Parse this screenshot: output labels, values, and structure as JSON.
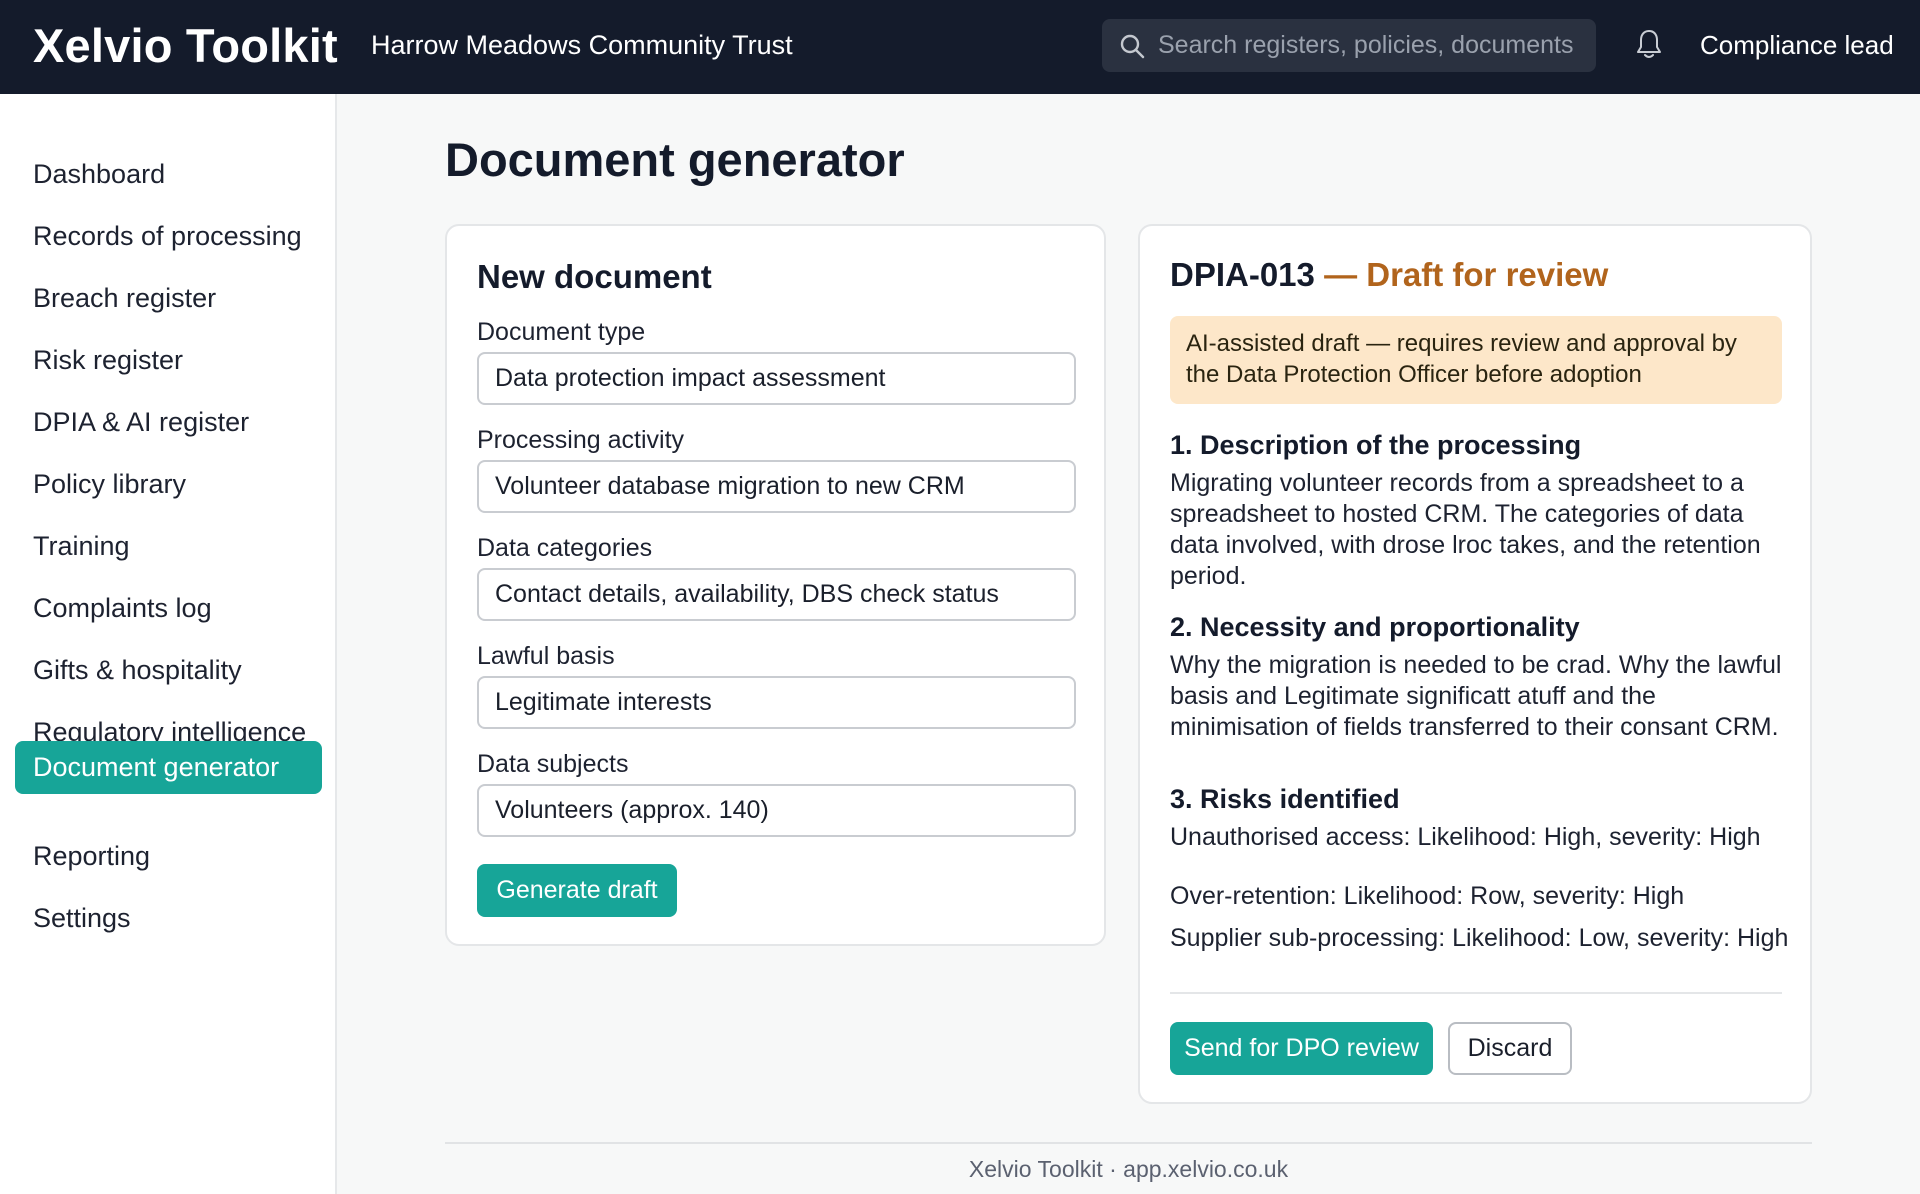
{
  "app": {
    "brand": "Xelvio Toolkit",
    "organisation": "Harrow Meadows Community Trust",
    "user_label": "Compliance lead"
  },
  "search": {
    "placeholder": "Search registers, policies, documents",
    "icon": "search-icon"
  },
  "notifications": {
    "icon": "bell-icon"
  },
  "sidebar": {
    "items": [
      {
        "label": "Dashboard"
      },
      {
        "label": "Records of processing"
      },
      {
        "label": "Breach register"
      },
      {
        "label": "Risk register"
      },
      {
        "label": "DPIA & AI register"
      },
      {
        "label": "Policy library"
      },
      {
        "label": "Training"
      },
      {
        "label": "Complaints log"
      },
      {
        "label": "Gifts & hospitality"
      },
      {
        "label": "Regulatory intelligence"
      },
      {
        "label": "Document generator",
        "active": true
      },
      {
        "label": "Reporting"
      },
      {
        "label": "Settings"
      }
    ]
  },
  "main": {
    "title": "Document generator"
  },
  "form": {
    "title": "New document",
    "fields": [
      {
        "label": "Document type",
        "value": "Data protection impact assessment"
      },
      {
        "label": "Processing activity",
        "value": "Volunteer database migration to new CRM"
      },
      {
        "label": "Data categories",
        "value": "Contact details, availability, DBS check status"
      },
      {
        "label": "Lawful basis",
        "value": "Legitimate interests"
      },
      {
        "label": "Data subjects",
        "value": "Volunteers (approx. 140)"
      }
    ],
    "generate_label": "Generate draft"
  },
  "draft": {
    "id": "DPIA-013",
    "separator": "—",
    "status": "Draft for review",
    "notice": "AI-assisted draft — requires review and approval by the Data Protection Officer before adoption",
    "sections": [
      {
        "title": "1. Description of the processing",
        "lines": [
          "Migrating volunteer records from a spreadsheet to a",
          "spreadsheet to hosted CRM. The categories of data",
          "data involved, with drose lroc takes, and the retention",
          "period."
        ]
      },
      {
        "title": "2. Necessity and proportionality",
        "lines": [
          "Why the migration is needed to be crad. Why the lawful",
          "basis and Legitimate significatt atuff and the",
          "minimisation of fields transferred to their consant CRM."
        ]
      },
      {
        "title": "3. Risks identified",
        "risks": [
          "Unauthorised access: Likelihood: High, severity: High",
          "Over-retention: Likelihood: Row, severity: High",
          "Supplier sub-processing: Likelihood: Low, severity: High"
        ]
      }
    ],
    "send_label": "Send for DPO review",
    "discard_label": "Discard"
  },
  "footer": {
    "text": "Xelvio Toolkit · app.xelvio.co.uk"
  },
  "colors": {
    "topbar": "#141b2b",
    "accent": "#17a598",
    "draft_status": "#b1641c",
    "notice_bg": "#fde7c9"
  }
}
